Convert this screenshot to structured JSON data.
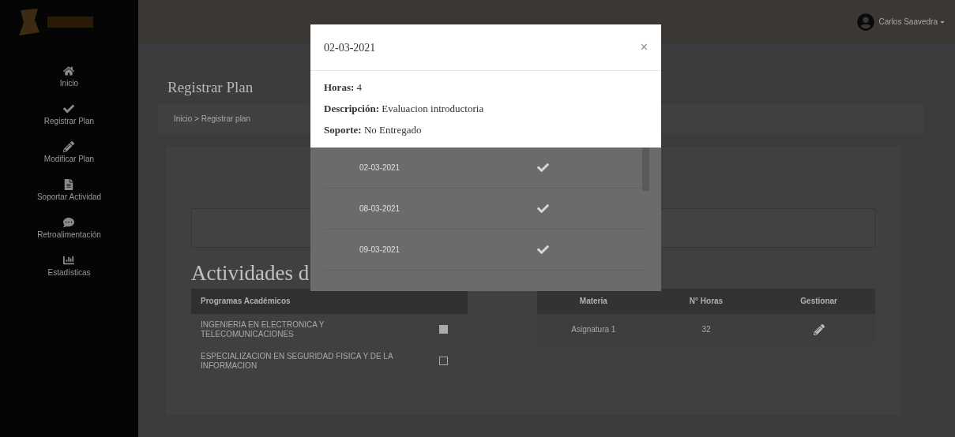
{
  "user": {
    "name": "Carlos Saavedra"
  },
  "sidebar": {
    "items": [
      {
        "label": "Inicio"
      },
      {
        "label": "Registrar Plan"
      },
      {
        "label": "Modificar Plan"
      },
      {
        "label": "Soportar Actividad"
      },
      {
        "label": "Retroalimentación"
      },
      {
        "label": "Estadísticas"
      }
    ]
  },
  "page": {
    "title": "Registrar Plan",
    "breadcrumb": "Inicio > Registrar plan",
    "section_heading": "Actividades d"
  },
  "programs": {
    "header": "Programas Académicos",
    "rows": [
      {
        "label": "INGENIERIA EN ELECTRONICA Y TELECOMUNICACIONES",
        "checked": true
      },
      {
        "label": "ESPECIALIZACION EN SEGURIDAD FISICA Y DE LA INFORMACION",
        "checked": false
      }
    ]
  },
  "subjects": {
    "columns": [
      "Materia",
      "N° Horas",
      "Gestionar"
    ],
    "rows": [
      {
        "subject": "Asignatura 1",
        "hours": "32"
      }
    ]
  },
  "activity_list": {
    "rows": [
      {
        "date": "02-03-2021",
        "done": true
      },
      {
        "date": "08-03-2021",
        "done": true
      },
      {
        "date": "09-03-2021",
        "done": true
      }
    ]
  },
  "modal": {
    "title": "02-03-2021",
    "close": "×",
    "fields": [
      {
        "label": "Horas:",
        "value": "4"
      },
      {
        "label": "Descripción:",
        "value": "Evaluacion introductoria"
      },
      {
        "label": "Soporte:",
        "value": "No Entregado"
      }
    ]
  }
}
